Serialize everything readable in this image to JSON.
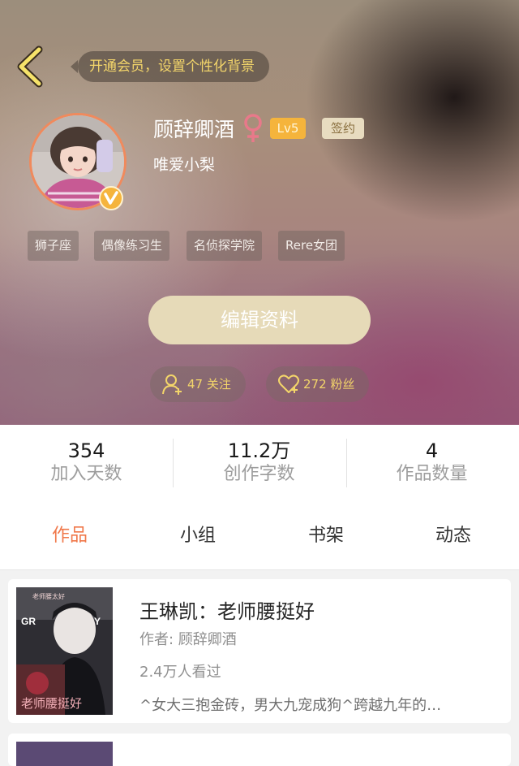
{
  "header": {
    "vip_banner": "开通会员，设置个性化背景",
    "username": "顾辞卿酒",
    "level_badge": "Lv5",
    "signed_badge": "签约",
    "signature": "唯爱小梨",
    "tags": [
      "狮子座",
      "偶像练习生",
      "名侦探学院",
      "Rere女团"
    ],
    "edit_button": "编辑资料",
    "following_label": "47 关注",
    "fans_label": "272 粉丝"
  },
  "stats": [
    {
      "value": "354",
      "label": "加入天数"
    },
    {
      "value": "11.2万",
      "label": "创作字数"
    },
    {
      "value": "4",
      "label": "作品数量"
    }
  ],
  "tabs": [
    "作品",
    "小组",
    "书架",
    "动态"
  ],
  "active_tab": "作品",
  "books": [
    {
      "title": "王琳凯：老师腰挺好",
      "author": "作者: 顾辞卿酒",
      "views": "2.4万人看过",
      "description": "^女大三抱金砖，男大九宠成狗^跨越九年的…",
      "cover_text": {
        "top": "老师腰太好",
        "left": "GR",
        "right": "Y",
        "big": "老师腰挺好"
      }
    }
  ],
  "colors": {
    "accent": "#f0784a",
    "gold_text": "#f3d56a",
    "level_badge": "#f5b43c",
    "edit_button": "#e6dab8",
    "gender_icon": "#e8798a"
  }
}
